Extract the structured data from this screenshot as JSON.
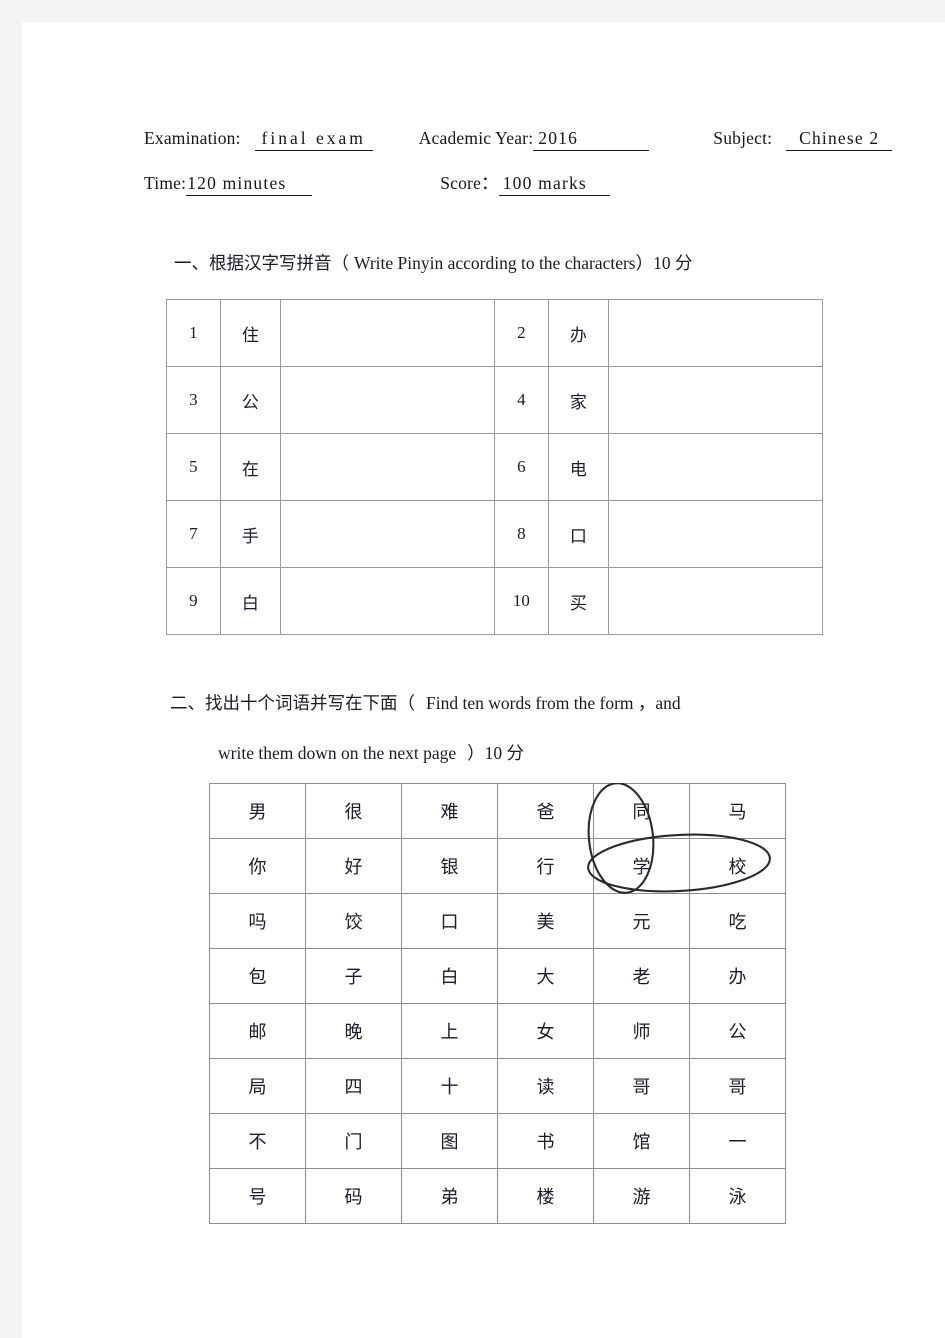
{
  "header": {
    "examination_label": "Examination:",
    "examination_value": "final exam",
    "academic_year_label": "Academic Year:",
    "academic_year_value": "2016",
    "subject_label": "Subject:",
    "subject_value": "Chinese 2",
    "time_label": "Time:",
    "time_value": "120 minutes",
    "score_label": "Score：",
    "score_value": "100 marks"
  },
  "sections": [
    {
      "number": "一、",
      "title_zh": "根据汉字写拼音",
      "paren_open": "（",
      "title_en": "Write Pinyin according to the characters",
      "paren_close": "）",
      "points": "10 分"
    },
    {
      "number": "二、",
      "title_zh": "找出十个词语并写在下面",
      "paren_open": "（",
      "title_en_line1": "Find ten words from the form ，and",
      "title_en_line2": "write them down on the next page",
      "paren_close": "）",
      "points": "10 分"
    }
  ],
  "pinyin_table": {
    "rows": [
      {
        "left_num": "1",
        "left_char": "住",
        "left_answer": "",
        "right_num": "2",
        "right_char": "办",
        "right_answer": ""
      },
      {
        "left_num": "3",
        "left_char": "公",
        "left_answer": "",
        "right_num": "4",
        "right_char": "家",
        "right_answer": ""
      },
      {
        "left_num": "5",
        "left_char": "在",
        "left_answer": "",
        "right_num": "6",
        "right_char": "电",
        "right_answer": ""
      },
      {
        "left_num": "7",
        "left_char": "手",
        "left_answer": "",
        "right_num": "8",
        "right_char": "口",
        "right_answer": ""
      },
      {
        "left_num": "9",
        "left_char": "白",
        "left_answer": "",
        "right_num": "10",
        "right_char": "买",
        "right_answer": ""
      }
    ]
  },
  "word_search_grid": {
    "rows": [
      [
        "男",
        "很",
        "难",
        "爸",
        "同",
        "马"
      ],
      [
        "你",
        "好",
        "银",
        "行",
        "学",
        "校"
      ],
      [
        "吗",
        "饺",
        "口",
        "美",
        "元",
        "吃"
      ],
      [
        "包",
        "子",
        "白",
        "大",
        "老",
        "办"
      ],
      [
        "邮",
        "晚",
        "上",
        "女",
        "师",
        "公"
      ],
      [
        "局",
        "四",
        "十",
        "读",
        "哥",
        "哥"
      ],
      [
        "不",
        "门",
        "图",
        "书",
        "馆",
        "一"
      ],
      [
        "号",
        "码",
        "弟",
        "楼",
        "游",
        "泳"
      ]
    ],
    "annotations": [
      {
        "name": "circled-tongxue-vertical",
        "shape": "ellipse",
        "covers": [
          "同",
          "学"
        ],
        "color": "#2b2b2b"
      },
      {
        "name": "circled-xuexiao-horizontal",
        "shape": "ellipse",
        "covers": [
          "学",
          "校"
        ],
        "color": "#2b2b2b"
      }
    ]
  }
}
